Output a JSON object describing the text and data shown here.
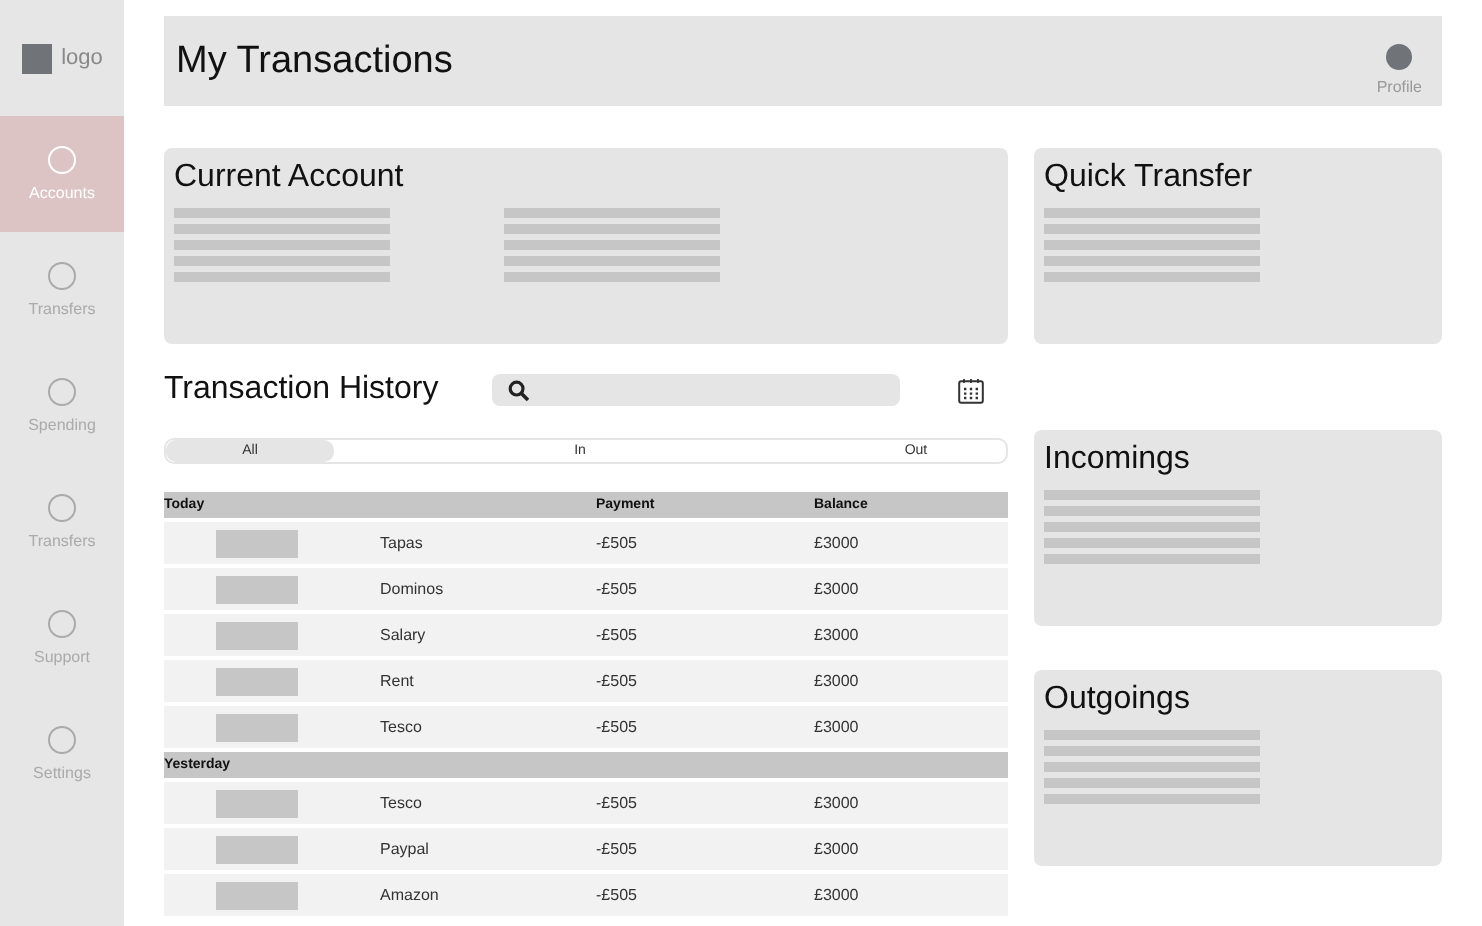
{
  "sidebar": {
    "logo": "logo",
    "items": [
      {
        "label": "Accounts",
        "selected": true
      },
      {
        "label": "Transfers",
        "selected": false
      },
      {
        "label": "Spending",
        "selected": false
      },
      {
        "label": "Transfers",
        "selected": false
      },
      {
        "label": "Support",
        "selected": false
      },
      {
        "label": "Settings",
        "selected": false
      }
    ]
  },
  "header": {
    "title": "My Transactions",
    "profile": "Profile"
  },
  "current_account": {
    "title": "Current Account"
  },
  "quick_transfer": {
    "title": "Quick Transfer"
  },
  "history": {
    "title": "Transaction History",
    "filters": [
      {
        "label": "All",
        "selected": true
      },
      {
        "label": "In",
        "selected": false
      },
      {
        "label": "Out",
        "selected": false
      }
    ],
    "columns": [
      "Payment",
      "Balance"
    ],
    "sections": [
      {
        "title": "Today",
        "rows": [
          {
            "name": "Tapas",
            "payment": "-£505",
            "balance": "£3000"
          },
          {
            "name": "Dominos",
            "payment": "-£505",
            "balance": "£3000"
          },
          {
            "name": "Salary",
            "payment": "-£505",
            "balance": "£3000"
          },
          {
            "name": "Rent",
            "payment": "-£505",
            "balance": "£3000"
          },
          {
            "name": "Tesco",
            "payment": "-£505",
            "balance": "£3000"
          }
        ]
      },
      {
        "title": "Yesterday",
        "rows": [
          {
            "name": "Tesco",
            "payment": "-£505",
            "balance": "£3000"
          },
          {
            "name": "Paypal",
            "payment": "-£505",
            "balance": "£3000"
          },
          {
            "name": "Amazon",
            "payment": "-£505",
            "balance": "£3000"
          }
        ]
      }
    ]
  },
  "incomings": {
    "title": "Incomings"
  },
  "outgoings": {
    "title": "Outgoings"
  }
}
